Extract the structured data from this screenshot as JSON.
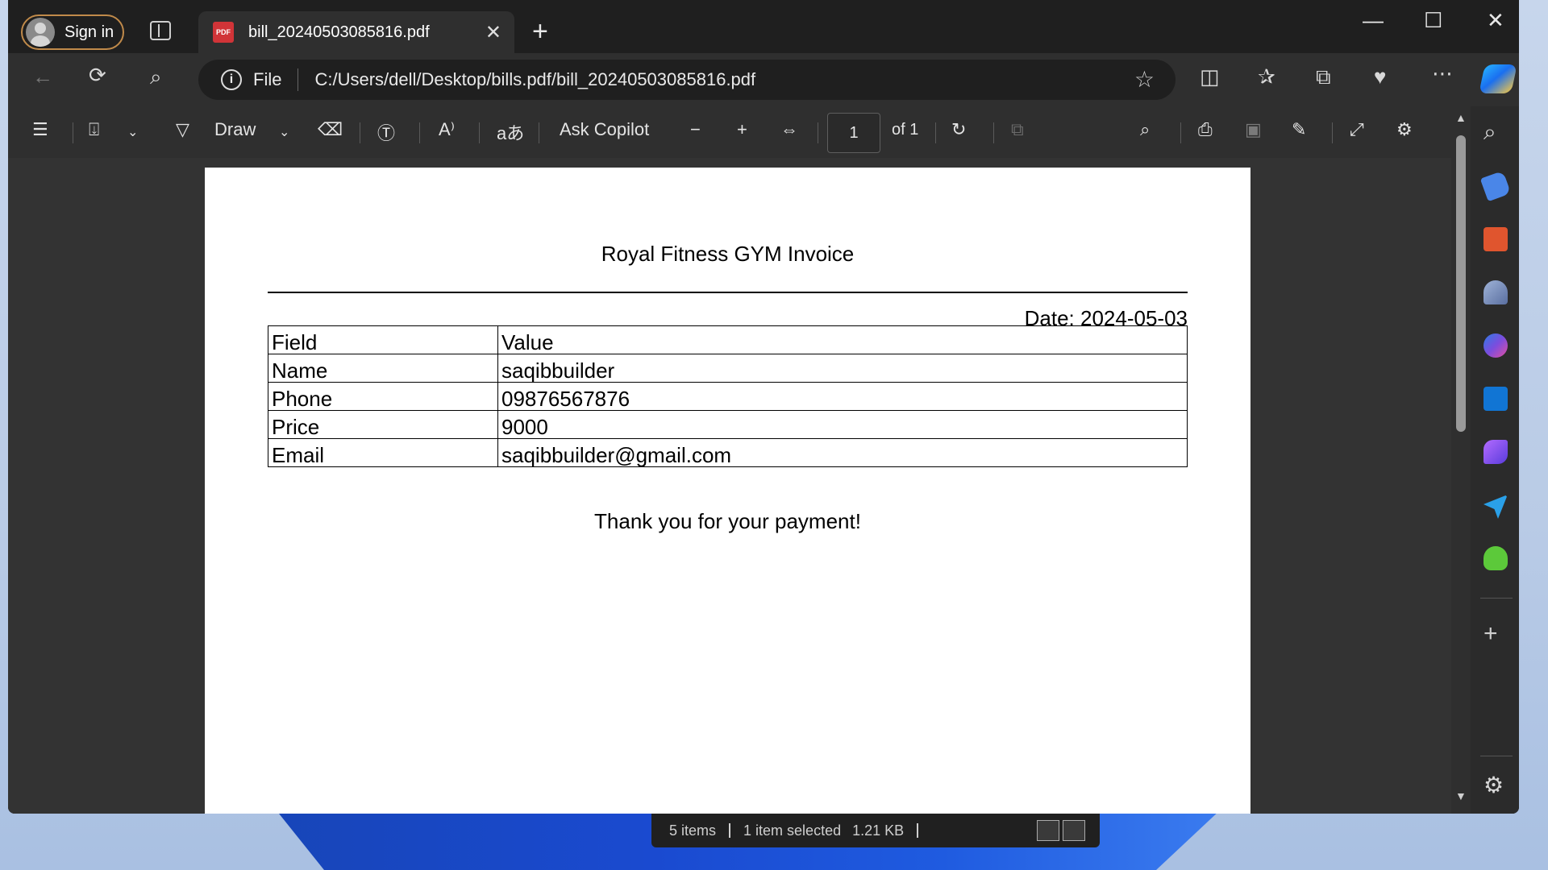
{
  "titlebar": {
    "signin_label": "Sign in",
    "tab_title": "bill_20240503085816.pdf",
    "pdf_icon_text": "PDF",
    "tab_close": "✕",
    "new_tab": "+",
    "minimize": "—",
    "maximize": "☐",
    "close": "✕"
  },
  "address": {
    "file_label": "File",
    "url": "C:/Users/dell/Desktop/bills.pdf/bill_20240503085816.pdf"
  },
  "pdf_toolbar": {
    "draw_label": "Draw",
    "ask_copilot_label": "Ask Copilot",
    "page_current": "1",
    "page_of": "of 1"
  },
  "document": {
    "title": "Royal Fitness GYM Invoice",
    "date": "Date: 2024-05-03",
    "table": {
      "header": [
        "Field",
        "Value"
      ],
      "rows": [
        [
          "Name",
          "saqibbuilder"
        ],
        [
          "Phone",
          "09876567876"
        ],
        [
          "Price",
          "9000"
        ],
        [
          "Email",
          "saqibbuilder@gmail.com"
        ]
      ]
    },
    "footer": "Thank you for your payment!"
  },
  "statusbar": {
    "items": "5 items",
    "selected": "1 item selected",
    "size": "1.21 KB"
  },
  "colors": {
    "accent_signin_border": "#c08a4a",
    "pdf_icon": "#d13438",
    "chrome_dark": "#1f1f1f",
    "toolbar": "#2f2f2f"
  }
}
